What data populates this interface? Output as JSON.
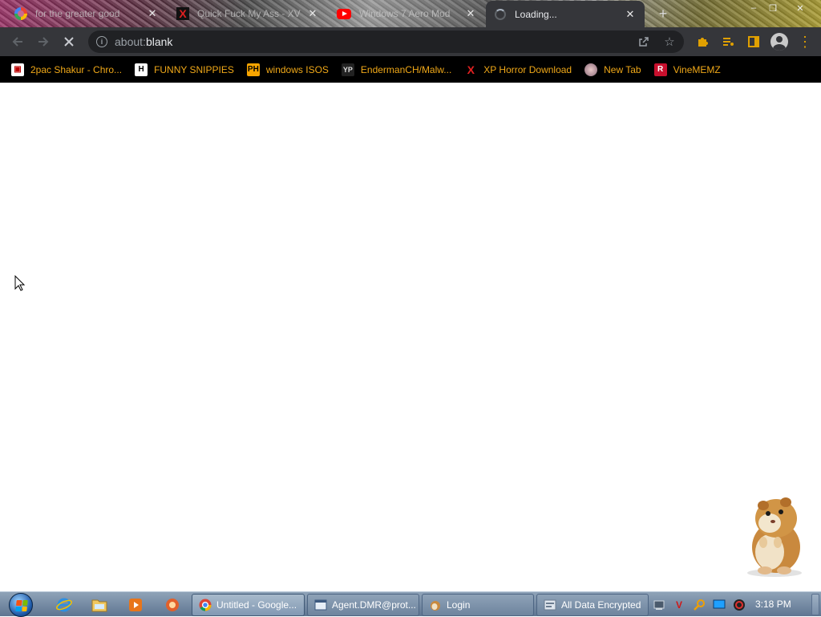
{
  "browser": {
    "tabs": [
      {
        "title": "for the greater good",
        "icon": "google-icon",
        "active": false
      },
      {
        "title": "Quick Fuck My Ass - XV",
        "icon": "x-site-icon",
        "active": false
      },
      {
        "title": "Windows 7 Aero Mod",
        "icon": "youtube-icon",
        "active": false
      },
      {
        "title": "Loading...",
        "icon": "loading-spinner-icon",
        "active": true
      }
    ],
    "new_tab": "+",
    "window_controls": {
      "minimize": "–",
      "maximize": "❐",
      "close": "✕"
    },
    "url_prefix": "about:",
    "url_main": "blank",
    "bookmarks": [
      {
        "label": "2pac Shakur - Chro...",
        "icon": "bookmark-2pac-icon"
      },
      {
        "label": "FUNNY SNIPPIES",
        "icon": "bookmark-h-icon"
      },
      {
        "label": "windows ISOS",
        "icon": "bookmark-ph-icon"
      },
      {
        "label": "EndermanCH/Malw...",
        "icon": "bookmark-yp-icon"
      },
      {
        "label": "XP Horror Download",
        "icon": "bookmark-x-icon"
      },
      {
        "label": "New Tab",
        "icon": "bookmark-newtab-icon"
      },
      {
        "label": "VineMEMZ",
        "icon": "bookmark-r-icon"
      }
    ]
  },
  "taskbar": {
    "items": [
      {
        "label": "Untitled - Google...",
        "icon": "chrome-icon",
        "active": true
      },
      {
        "label": "Agent.DMR@prot...",
        "icon": "app-window-icon",
        "active": false
      },
      {
        "label": "Login",
        "icon": "hamster-app-icon",
        "active": false
      },
      {
        "label": "All Data Encrypted",
        "icon": "encrypted-window-icon",
        "active": false
      }
    ],
    "clock": "3:18 PM"
  },
  "colors": {
    "tab_active": "#35363a",
    "toolbar": "#35363a",
    "omnibox": "#202124",
    "bookmarks_bar": "#000000",
    "bookmark_text": "#f0a818",
    "taskbar": "#6f86a1"
  }
}
